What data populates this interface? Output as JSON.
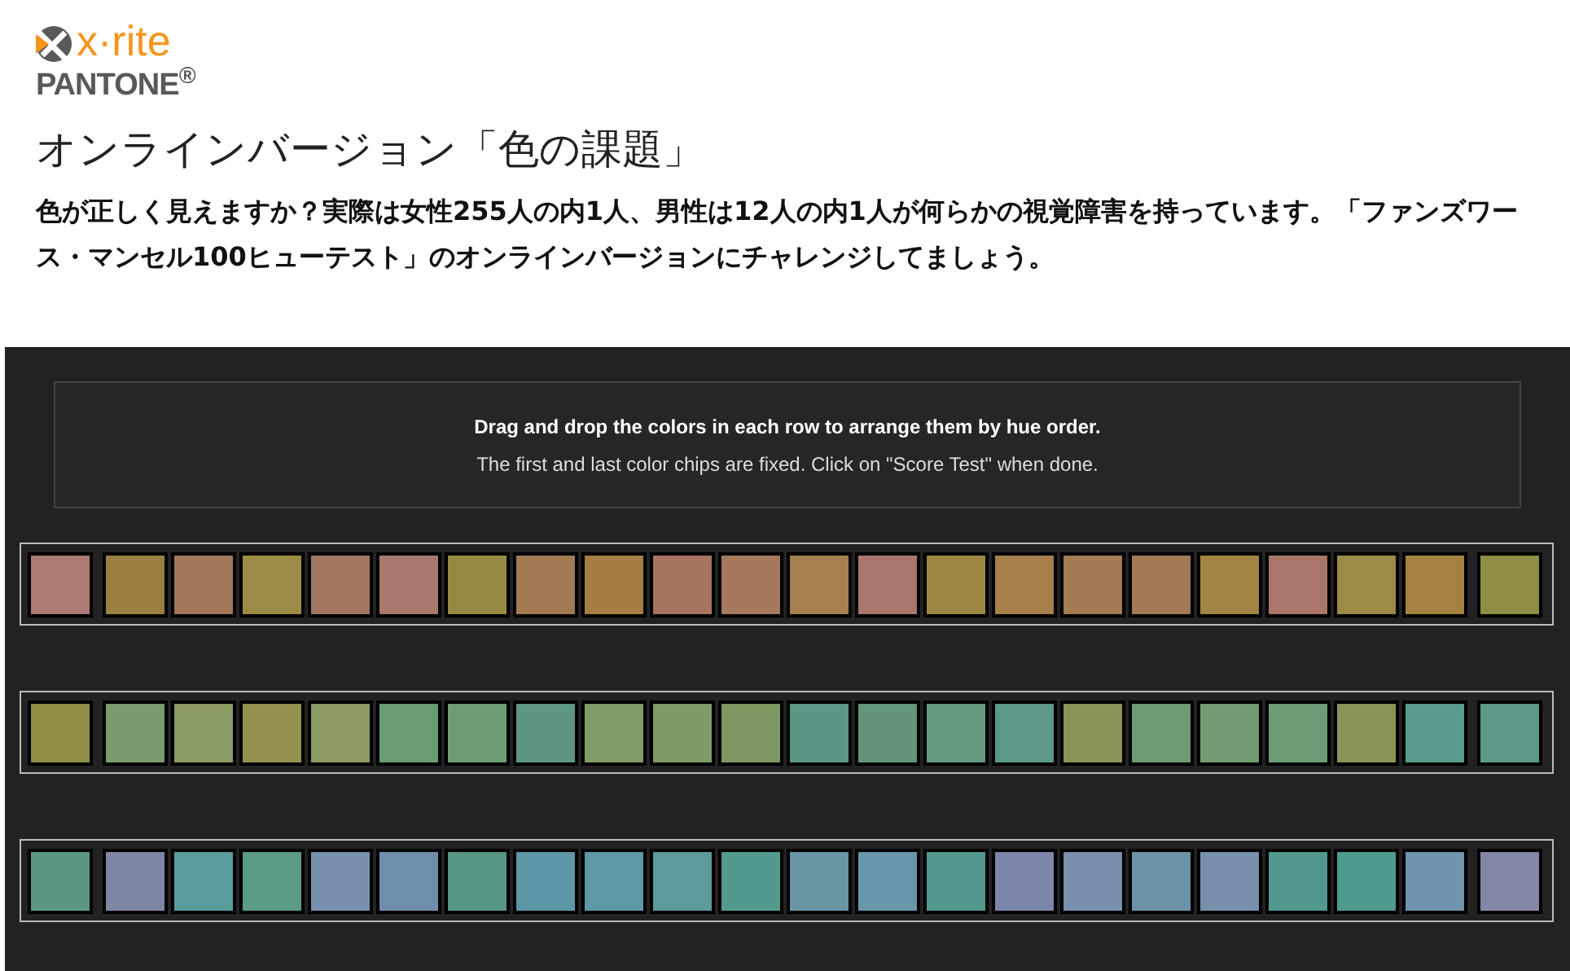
{
  "logo": {
    "wordmark": "x·rite",
    "brand": "PANTONE$^{®}$"
  },
  "title": "オンラインバージョン「色の課題」",
  "intro": "色が正しく見えますか？実際は女性255人の内1人、男性は12人の内1人が何らかの視覚障害を持っています。「ファンズワース・マンセル100ヒューテスト」のオンラインバージョンにチャレンジしてましょう。",
  "instructions": {
    "heading": "Drag and drop the colors in each row to arrange them by hue order.",
    "note": "The first and last color chips are fixed. Click on \"Score Test\" when done."
  },
  "rows": [
    {
      "chips": [
        {
          "kind": "fixed",
          "color": "#ab7a72"
        },
        {
          "kind": "movable",
          "color": "#9a8040"
        },
        {
          "kind": "movable",
          "color": "#a3775a"
        },
        {
          "kind": "movable",
          "color": "#9b8c45"
        },
        {
          "kind": "movable",
          "color": "#a37862"
        },
        {
          "kind": "movable",
          "color": "#a8786c"
        },
        {
          "kind": "movable",
          "color": "#958a42"
        },
        {
          "kind": "movable",
          "color": "#a37a52"
        },
        {
          "kind": "movable",
          "color": "#a67d42"
        },
        {
          "kind": "movable",
          "color": "#a77462"
        },
        {
          "kind": "movable",
          "color": "#a6785c"
        },
        {
          "kind": "movable",
          "color": "#a6804e"
        },
        {
          "kind": "movable",
          "color": "#aa766c"
        },
        {
          "kind": "movable",
          "color": "#9c8742"
        },
        {
          "kind": "movable",
          "color": "#a67f4a"
        },
        {
          "kind": "movable",
          "color": "#a47b52"
        },
        {
          "kind": "movable",
          "color": "#a37a56"
        },
        {
          "kind": "movable",
          "color": "#a28542"
        },
        {
          "kind": "movable",
          "color": "#aa766a"
        },
        {
          "kind": "movable",
          "color": "#9b8b47"
        },
        {
          "kind": "movable",
          "color": "#a4823f"
        },
        {
          "kind": "fixed",
          "color": "#8e8e44"
        }
      ]
    },
    {
      "chips": [
        {
          "kind": "fixed",
          "color": "#8e8e44"
        },
        {
          "kind": "movable",
          "color": "#7b9a6e"
        },
        {
          "kind": "movable",
          "color": "#8a9a64"
        },
        {
          "kind": "movable",
          "color": "#94914f"
        },
        {
          "kind": "movable",
          "color": "#8a9a62"
        },
        {
          "kind": "movable",
          "color": "#699b74"
        },
        {
          "kind": "movable",
          "color": "#6e9c76"
        },
        {
          "kind": "movable",
          "color": "#5d9681"
        },
        {
          "kind": "movable",
          "color": "#819b66"
        },
        {
          "kind": "movable",
          "color": "#7e9a66"
        },
        {
          "kind": "movable",
          "color": "#7f9862"
        },
        {
          "kind": "movable",
          "color": "#5c9686"
        },
        {
          "kind": "movable",
          "color": "#62957a"
        },
        {
          "kind": "movable",
          "color": "#64987f"
        },
        {
          "kind": "movable",
          "color": "#5c9888"
        },
        {
          "kind": "movable",
          "color": "#8a9459"
        },
        {
          "kind": "movable",
          "color": "#6d9a73"
        },
        {
          "kind": "movable",
          "color": "#739b72"
        },
        {
          "kind": "movable",
          "color": "#6c9b76"
        },
        {
          "kind": "movable",
          "color": "#8a9458"
        },
        {
          "kind": "movable",
          "color": "#5a9a8c"
        },
        {
          "kind": "fixed",
          "color": "#5c9888"
        }
      ]
    },
    {
      "chips": [
        {
          "kind": "fixed",
          "color": "#5b9884"
        },
        {
          "kind": "movable",
          "color": "#7e86a6"
        },
        {
          "kind": "movable",
          "color": "#5a9c9c"
        },
        {
          "kind": "movable",
          "color": "#5c9a88"
        },
        {
          "kind": "movable",
          "color": "#7890ae"
        },
        {
          "kind": "movable",
          "color": "#6f8eac"
        },
        {
          "kind": "movable",
          "color": "#589686"
        },
        {
          "kind": "movable",
          "color": "#5d96a6"
        },
        {
          "kind": "movable",
          "color": "#5d98a6"
        },
        {
          "kind": "movable",
          "color": "#5c9a9e"
        },
        {
          "kind": "movable",
          "color": "#539a8e"
        },
        {
          "kind": "movable",
          "color": "#6896a4"
        },
        {
          "kind": "movable",
          "color": "#6896aa"
        },
        {
          "kind": "movable",
          "color": "#52988e"
        },
        {
          "kind": "movable",
          "color": "#7c86aa"
        },
        {
          "kind": "movable",
          "color": "#7a8eae"
        },
        {
          "kind": "movable",
          "color": "#6c92a8"
        },
        {
          "kind": "movable",
          "color": "#7890ac"
        },
        {
          "kind": "movable",
          "color": "#52988e"
        },
        {
          "kind": "movable",
          "color": "#4e9a8e"
        },
        {
          "kind": "movable",
          "color": "#7094ae"
        },
        {
          "kind": "fixed",
          "color": "#8486a8"
        }
      ]
    }
  ]
}
